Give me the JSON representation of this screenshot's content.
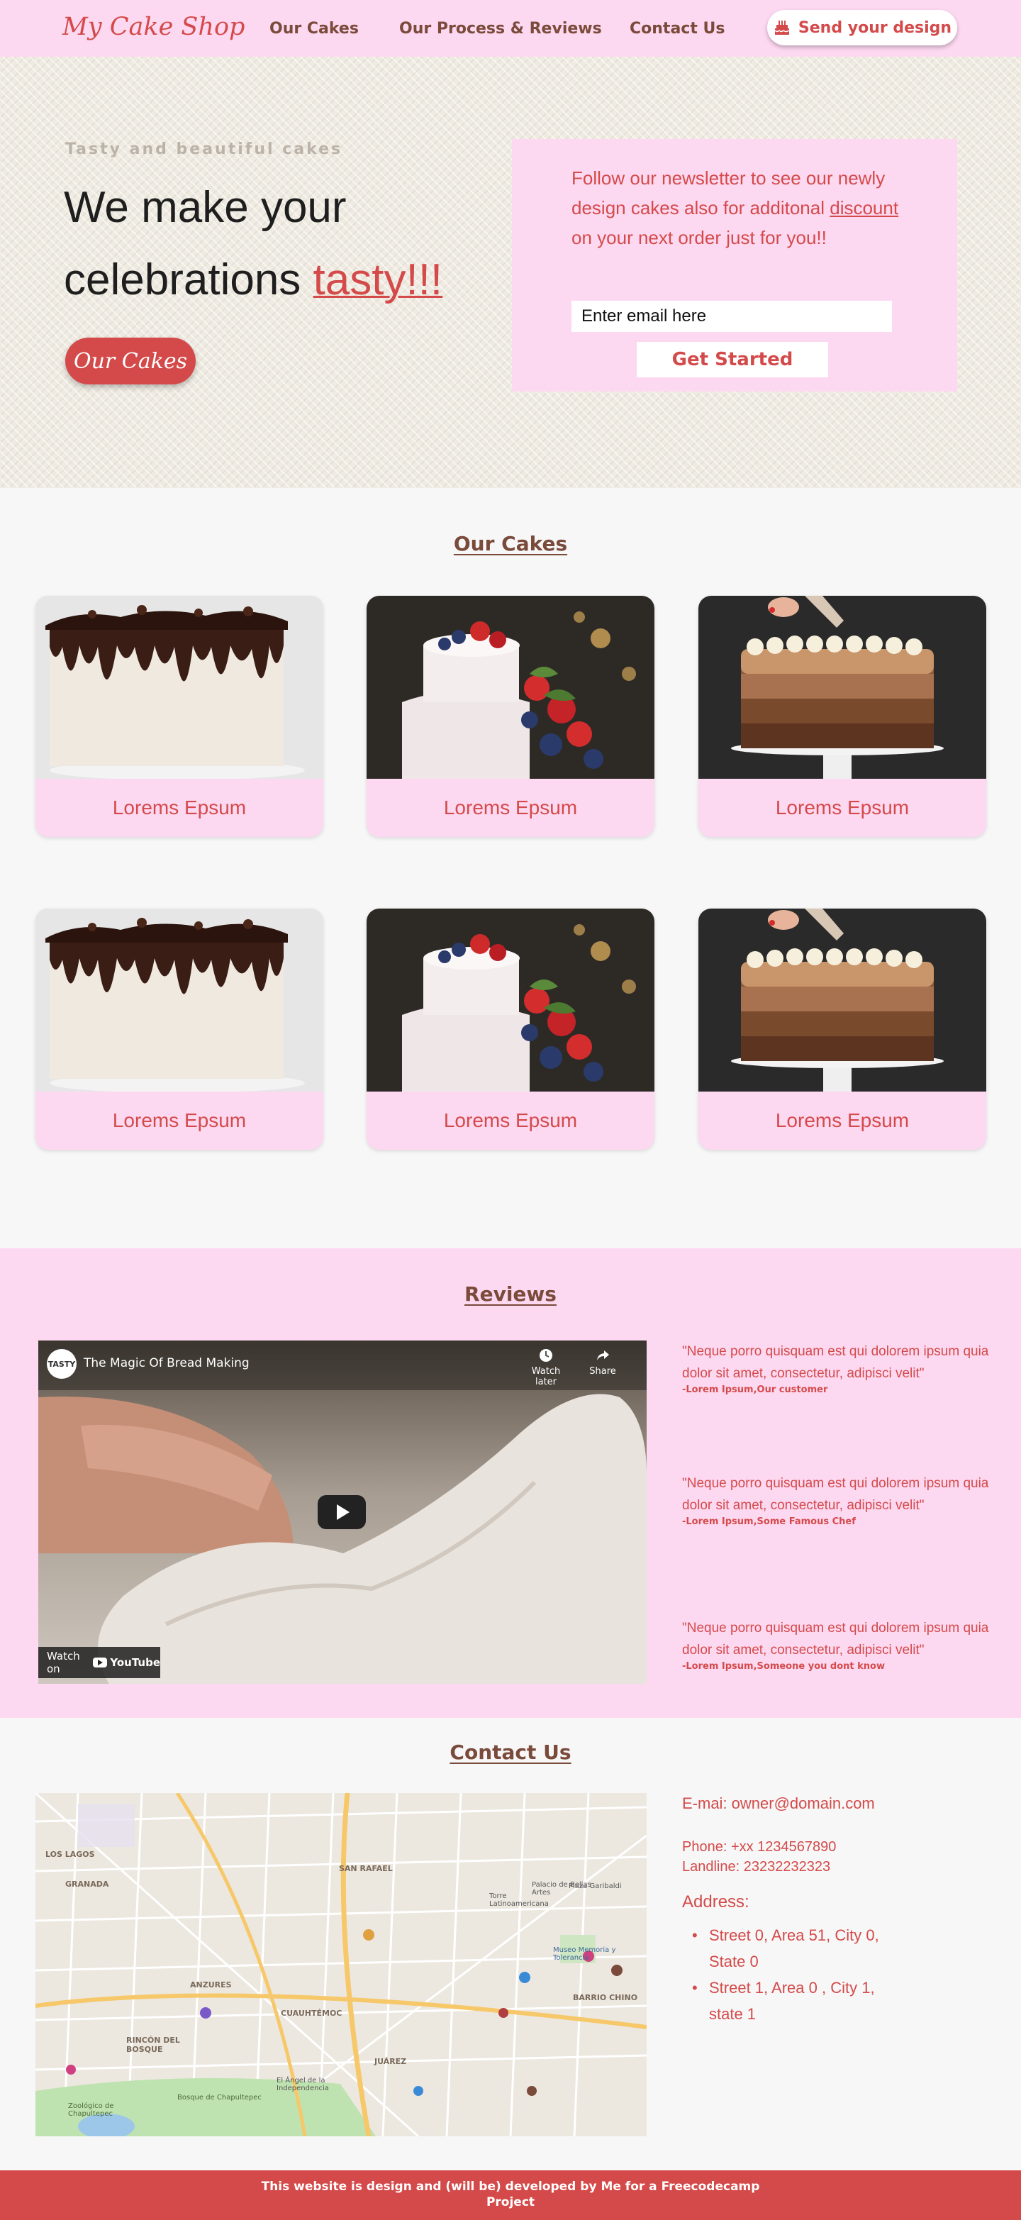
{
  "nav": {
    "brand": "My Cake Shop",
    "links": [
      "Our Cakes",
      "Our Process & Reviews",
      "Contact Us"
    ],
    "cta_label": "Send your design",
    "cta_icon": "cake-icon"
  },
  "hero": {
    "tagline": "Tasty and beautiful cakes",
    "title_line1": "We make your",
    "title_line2_prefix": "celebrations ",
    "title_accent": "tasty!!!",
    "button_label": "Our Cakes",
    "newsletter": {
      "text_before": "Follow our newsletter to see our newly design cakes also for additonal ",
      "link_word": "discount",
      "text_after": " on your next order just for you!!",
      "email_placeholder": "Enter email here",
      "submit_label": "Get Started"
    }
  },
  "cakes": {
    "title": "Our Cakes",
    "items": [
      {
        "caption": "Lorems Epsum",
        "image": "drip-cake"
      },
      {
        "caption": "Lorems Epsum",
        "image": "berry-cake"
      },
      {
        "caption": "Lorems Epsum",
        "image": "ombre-cake"
      },
      {
        "caption": "Lorems Epsum",
        "image": "drip-cake"
      },
      {
        "caption": "Lorems Epsum",
        "image": "berry-cake"
      },
      {
        "caption": "Lorems Epsum",
        "image": "ombre-cake"
      }
    ]
  },
  "reviews": {
    "title": "Reviews",
    "video": {
      "title": "The Magic Of Bread Making",
      "channel": "TASTY",
      "watch_later": "Watch later",
      "share": "Share",
      "watch_on": "Watch on",
      "platform": "YouTube"
    },
    "items": [
      {
        "quote": "\"Neque porro quisquam est qui dolorem ipsum quia dolor sit amet, consectetur, adipisci velit\"",
        "author": "-Lorem Ipsum,Our customer"
      },
      {
        "quote": "\"Neque porro quisquam est qui dolorem ipsum quia dolor sit amet, consectetur, adipisci velit\"",
        "author": "-Lorem Ipsum,Some Famous Chef"
      },
      {
        "quote": "\"Neque porro quisquam est qui dolorem ipsum quia dolor sit amet, consectetur, adipisci velit\"",
        "author": "-Lorem Ipsum,Someone you dont know"
      }
    ]
  },
  "contact": {
    "title": "Contact Us",
    "email": "E-mai: owner@domain.com",
    "phone": "Phone: +xx 1234567890",
    "landline": "Landline: 23232232323",
    "address_label": "Address:",
    "addresses": [
      "Street 0, Area 51, City 0, State 0",
      "Street 1, Area 0 , City 1, state 1"
    ],
    "map_labels": [
      "SAN RAFAEL",
      "CUAUHTÉMOC",
      "JUÁREZ",
      "ANZURES",
      "BARRIO CHINO",
      "RINCÓN DEL BOSQUE",
      "Zoológico de Chapultepec",
      "Bosque de Chapultepec",
      "GRANADA",
      "LOS LAGOS",
      "Museo Memoria y Tolerancia",
      "El Ángel de la Independencia",
      "Torre Latinoamericana",
      "Palacio de Bellas Artes",
      "Plaza Garibaldi"
    ]
  },
  "footer": {
    "line1": "This website is design and (will be) developed by Me for a Freecodecamp",
    "line2": "Project"
  },
  "colors": {
    "accent_red": "#d44a4a",
    "pink": "#fdd8f1",
    "brown": "#7a4a3a"
  }
}
